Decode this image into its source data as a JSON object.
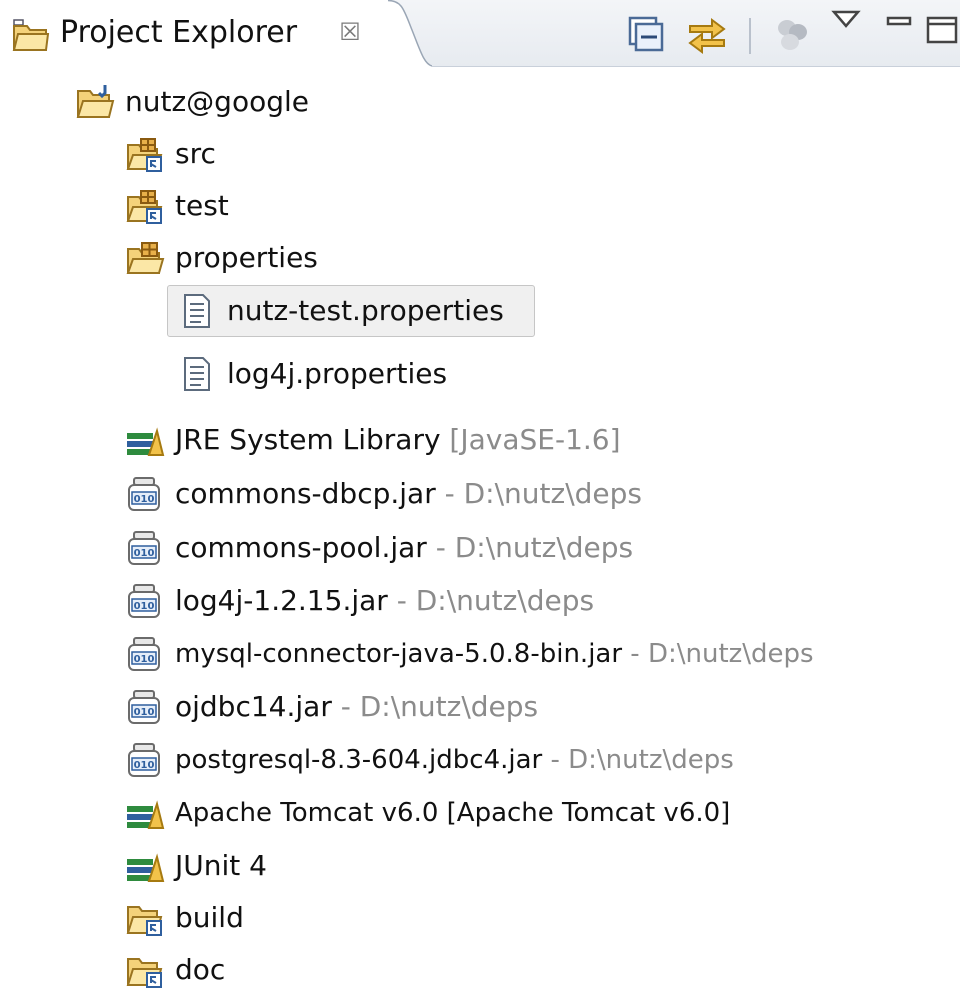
{
  "view": {
    "title": "Project Explorer",
    "close_glyph": "☒",
    "toolbar": [
      {
        "name": "collapse-all-icon"
      },
      {
        "name": "link-with-editor-icon"
      },
      {
        "name": "view-options-icon"
      },
      {
        "name": "view-menu-icon"
      },
      {
        "name": "minimize-icon"
      },
      {
        "name": "maximize-icon"
      }
    ]
  },
  "tree": [
    {
      "label": "nutz@google",
      "decoration": "",
      "icon": "project-folder-icon",
      "depth": 0,
      "selected": false
    },
    {
      "label": "src",
      "decoration": "",
      "icon": "source-folder-icon",
      "depth": 1,
      "selected": false
    },
    {
      "label": "test",
      "decoration": "",
      "icon": "source-folder-icon",
      "depth": 1,
      "selected": false
    },
    {
      "label": "properties",
      "decoration": "",
      "icon": "package-folder-icon",
      "depth": 1,
      "selected": false
    },
    {
      "label": "nutz-test.properties",
      "decoration": "",
      "icon": "text-file-icon",
      "depth": 2,
      "selected": true
    },
    {
      "label": "log4j.properties",
      "decoration": "",
      "icon": "text-file-icon",
      "depth": 2,
      "selected": false
    },
    {
      "label": "JRE System Library",
      "decoration": " [JavaSE-1.6]",
      "icon": "library-icon",
      "depth": 1,
      "selected": false
    },
    {
      "label": "commons-dbcp.jar",
      "decoration": " - D:\\nutz\\deps",
      "icon": "jar-icon",
      "depth": 1,
      "selected": false
    },
    {
      "label": "commons-pool.jar",
      "decoration": " - D:\\nutz\\deps",
      "icon": "jar-icon",
      "depth": 1,
      "selected": false
    },
    {
      "label": "log4j-1.2.15.jar",
      "decoration": " - D:\\nutz\\deps",
      "icon": "jar-icon",
      "depth": 1,
      "selected": false
    },
    {
      "label": "mysql-connector-java-5.0.8-bin.jar",
      "decoration": " - D:\\nutz\\deps",
      "icon": "jar-icon",
      "depth": 1,
      "selected": false
    },
    {
      "label": "ojdbc14.jar",
      "decoration": " - D:\\nutz\\deps",
      "icon": "jar-icon",
      "depth": 1,
      "selected": false
    },
    {
      "label": "postgresql-8.3-604.jdbc4.jar",
      "decoration": " - D:\\nutz\\deps",
      "icon": "jar-icon",
      "depth": 1,
      "selected": false
    },
    {
      "label": "Apache Tomcat v6.0 [Apache Tomcat v6.0]",
      "decoration": "",
      "icon": "library-icon",
      "depth": 1,
      "selected": false
    },
    {
      "label": "JUnit 4",
      "decoration": "",
      "icon": "library-icon",
      "depth": 1,
      "selected": false
    },
    {
      "label": "build",
      "decoration": "",
      "icon": "folder-icon",
      "depth": 1,
      "selected": false
    },
    {
      "label": "doc",
      "decoration": "",
      "icon": "folder-icon",
      "depth": 1,
      "selected": false
    }
  ],
  "colors": {
    "tab_band": "#e7ebf0",
    "decoration_text": "#8b8b8b",
    "selection_bg": "#f0f0f0",
    "folder_yellow": "#f2cf62",
    "jar_blue": "#2f5f9e",
    "library_green": "#2e8b3e"
  }
}
